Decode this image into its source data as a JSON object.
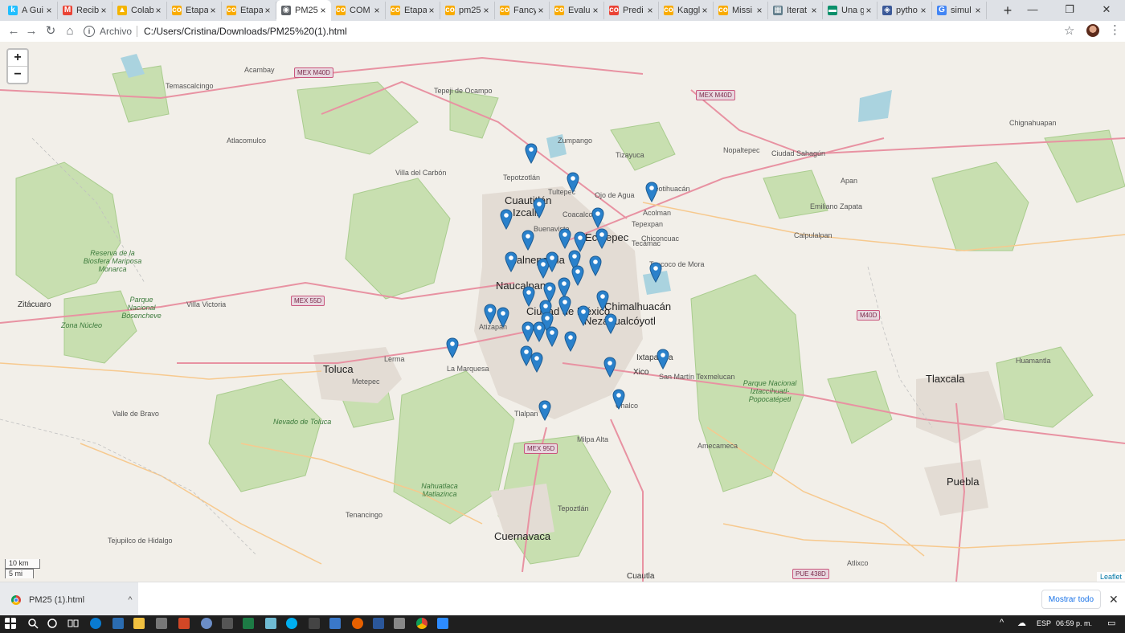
{
  "browser": {
    "tabs": [
      {
        "label": "A Gui",
        "favicon": "k",
        "color": "#20beff",
        "close": "×"
      },
      {
        "label": "Recib",
        "favicon": "M",
        "color": "#ea4335",
        "close": "×"
      },
      {
        "label": "Colab",
        "favicon": "▲",
        "color": "#f4b400",
        "close": "×"
      },
      {
        "label": "Etapa",
        "favicon": "co",
        "color": "#f9ab00",
        "close": "×"
      },
      {
        "label": "Etapa",
        "favicon": "co",
        "color": "#f9ab00",
        "close": "×"
      },
      {
        "label": "PM25",
        "favicon": "◉",
        "color": "#5f6368",
        "close": "×"
      },
      {
        "label": "COM",
        "favicon": "co",
        "color": "#f9ab00",
        "close": "×"
      },
      {
        "label": "Etapa",
        "favicon": "co",
        "color": "#f9ab00",
        "close": "×"
      },
      {
        "label": "pm25",
        "favicon": "co",
        "color": "#f9ab00",
        "close": "×"
      },
      {
        "label": "Fancy",
        "favicon": "co",
        "color": "#f9ab00",
        "close": "×"
      },
      {
        "label": "Evalu",
        "favicon": "co",
        "color": "#f9ab00",
        "close": "×"
      },
      {
        "label": "Predi",
        "favicon": "co",
        "color": "#ea4335",
        "close": "×"
      },
      {
        "label": "Kaggl",
        "favicon": "co",
        "color": "#f9ab00",
        "close": "×"
      },
      {
        "label": "Missi",
        "favicon": "co",
        "color": "#f9ab00",
        "close": "×"
      },
      {
        "label": "Iterat",
        "favicon": "▦",
        "color": "#607d8b",
        "close": "×"
      },
      {
        "label": "Una g",
        "favicon": "▬",
        "color": "#0a8f6a",
        "close": "×"
      },
      {
        "label": "pytho",
        "favicon": "◈",
        "color": "#3b5998",
        "close": "×"
      },
      {
        "label": "simul",
        "favicon": "G",
        "color": "#4285f4",
        "close": "×"
      }
    ],
    "active_tab": 5,
    "new_tab": "+",
    "window_controls": {
      "minimize": "—",
      "maximize": "❐",
      "close": "✕"
    },
    "nav": {
      "back": "←",
      "forward": "→",
      "reload": "↻",
      "home": "⌂"
    },
    "address": {
      "info": "i",
      "scheme": "Archivo",
      "url": "C:/Users/Cristina/Downloads/PM25%20(1).html"
    },
    "bookmark_star": "☆",
    "menu": "⋮"
  },
  "map": {
    "zoom_in": "+",
    "zoom_out": "−",
    "scale_km": "10 km",
    "scale_mi": "5 mi",
    "attribution": "Leaflet",
    "marker_color": "#2a81cb",
    "labels": {
      "cdmx": "Ciudad de México",
      "cuautitlan": "Cuautitlán",
      "izcalli": "Izcalli",
      "tlalnepantla": "Tlalnepantla",
      "naucalpan": "Naucalpan",
      "ecatepec": "Ecatepec",
      "nezahualcoyotl": "Nezahualcóyotl",
      "chimalhuacan": "Chimalhuacán",
      "toluca": "Toluca",
      "tlaxcala": "Tlaxcala",
      "puebla": "Puebla",
      "cuernavaca": "Cuernavaca",
      "ixtapaluca": "Ixtapaluca",
      "xico": "Xico",
      "zitacuaro": "Zitácuaro",
      "teotihuacan": "Teotihuacán",
      "acolman": "Acolman",
      "texcoco": "Texcoco de Mora",
      "buenavista": "Buenavista",
      "tultepec": "Tultepec",
      "coacalco": "Coacalco",
      "zumpango": "Zumpango",
      "tepotzotlan": "Tepotzotlán",
      "villa_victoria": "Villa Victoria",
      "temascalcingo": "Temascalcingo",
      "acambay": "Acambay",
      "atlacomulco": "Atlacomulco",
      "villa_carbon": "Villa del Carbón",
      "tepeji": "Tepeji de Ocampo",
      "tizayuca": "Tizayuca",
      "apan": "Apan",
      "calpulalpan": "Calpulalpan",
      "huamantla": "Huamantla",
      "chiconcuac": "Chiconcuac",
      "chalco": "Chalco",
      "amecameca": "Amecameca",
      "milpa_alta": "Milpa Alta",
      "tepoztlan": "Tepoztlán",
      "metepec": "Metepec",
      "lerma": "Lerma",
      "la_marquesa": "La Marquesa",
      "tenancingo": "Tenancingo",
      "valle_bravo": "Valle de Bravo",
      "tejupilco": "Tejupilco de Hidalgo",
      "cuautla": "Cuautla",
      "atlixco": "Atlixco",
      "san_martin": "San Martín Texmelucan",
      "nevado": "Nevado de Toluca",
      "izta": "Parque Nacional Iztaccíhuatl-Popocatépetl",
      "monarca": "Reserva de la Biosfera Mariposa Monarca",
      "bosencheve": "Parque Nacional Bosencheve",
      "zona_nucleo": "Zona Núcleo",
      "lagunas": "Nahuatlaca Matlazinca",
      "atizapan": "Atizapán",
      "tlalpan": "Tlalpan",
      "ojo_agua": "Ojo de Agua",
      "tecamac": "Tecámac",
      "tepexpan": "Tepexpan",
      "emiliano": "Emiliano Zapata",
      "sahagun": "Ciudad Sahagún",
      "nopaltepec": "Nopaltepec",
      "chignahuapan": "Chignahuapan"
    },
    "shields": [
      "MEX M40D",
      "MEX M40D",
      "MEX 55D",
      "MEX 95D",
      "M40D",
      "PUE 438D"
    ]
  },
  "downloads": {
    "file_name": "PM25 (1).html",
    "chevron": "^",
    "show_all": "Mostrar todo",
    "close": "✕"
  },
  "taskbar": {
    "language": "ESP",
    "time": "06:59 p. m."
  }
}
